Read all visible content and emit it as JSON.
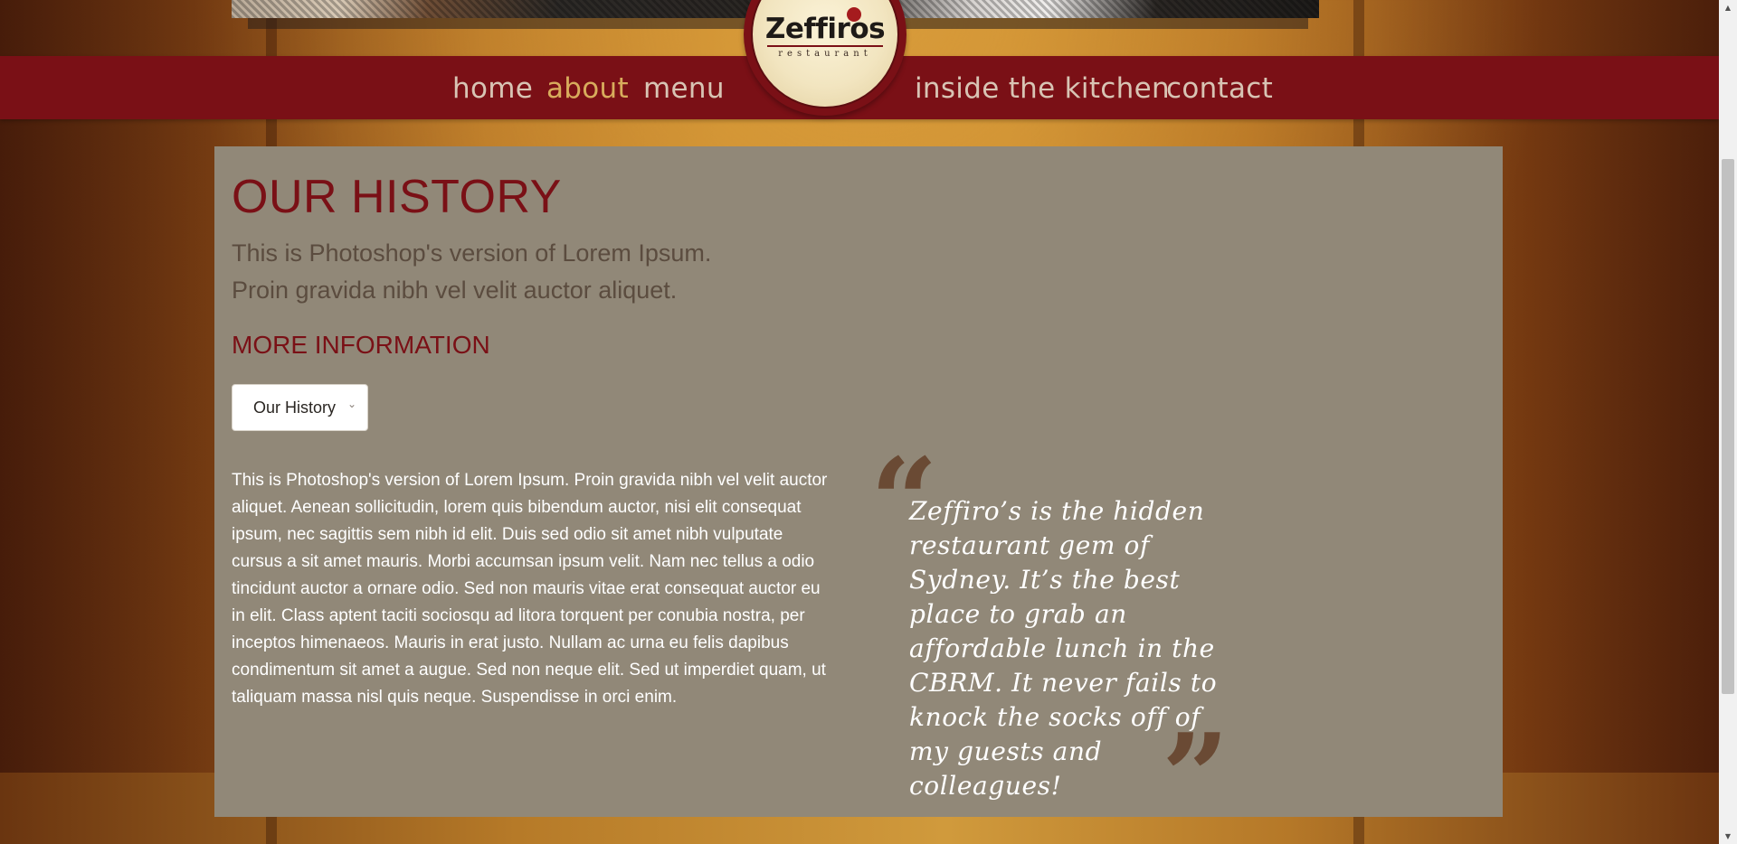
{
  "brand": {
    "name": "Zeffiros",
    "tagline": "restaurant"
  },
  "nav": {
    "items": [
      {
        "label": "home"
      },
      {
        "label": "about"
      },
      {
        "label": "menu"
      },
      {
        "label": "inside the kitchen"
      },
      {
        "label": "contact"
      }
    ],
    "active": "about"
  },
  "main": {
    "title": "OUR HISTORY",
    "intro": [
      "This is Photoshop's version of Lorem Ipsum.",
      "Proin gravida nibh vel velit auctor aliquet."
    ],
    "section_heading": "MORE INFORMATION",
    "dropdown": {
      "selected": "Our History"
    },
    "body": "This is Photoshop's version of Lorem Ipsum. Proin gravida nibh vel velit auctor aliquet. Aenean sollicitudin, lorem quis bibendum auctor, nisi elit consequat ipsum, nec sagittis sem nibh id elit. Duis sed odio sit amet nibh vulputate cursus a sit amet mauris. Morbi accumsan ipsum velit. Nam nec tellus a odio tincidunt auctor a ornare odio. Sed non mauris vitae erat consequat auctor eu in elit. Class aptent taciti sociosqu ad litora torquent per conubia nostra, per inceptos himenaeos. Mauris in erat justo. Nullam ac urna eu felis dapibus condimentum sit amet a augue. Sed non neque elit. Sed ut imperdiet quam, ut taliquam massa nisl quis neque. Suspendisse in orci enim.",
    "testimonial": "Zeffiro’s is the hidden restaurant gem of Sydney. It’s the best place to grab an affordable lunch in the CBRM. It never fails to knock the socks off of my guests and colleagues!"
  },
  "colors": {
    "nav_bg": "#7a1016",
    "nav_text": "#d8c4b4",
    "nav_active": "#d8ac5c",
    "panel_bg": "#918878",
    "heading": "#7a1016",
    "quote_marks": "#6a4a34"
  },
  "icons": {
    "dropdown": "chevron-down-icon",
    "quote_open": "quote-open-icon",
    "quote_close": "quote-close-icon"
  }
}
